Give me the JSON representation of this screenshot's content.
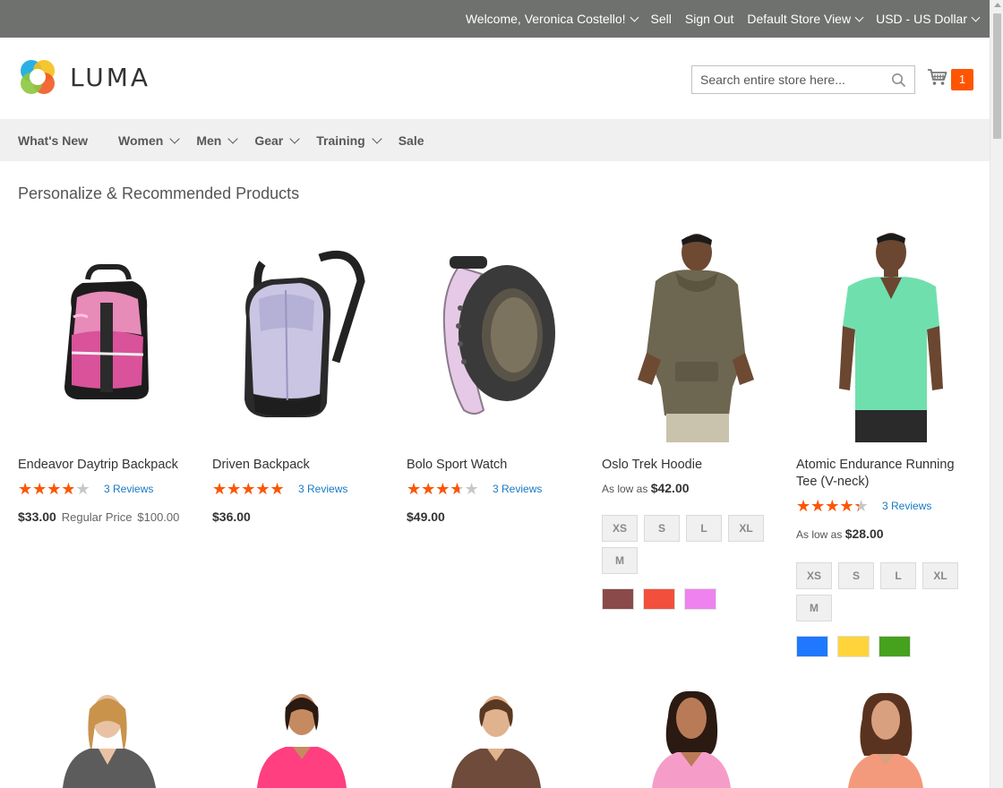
{
  "topbar": {
    "welcome": "Welcome, Veronica Costello!",
    "sell": "Sell",
    "sign_out": "Sign Out",
    "store_view": "Default Store View",
    "currency": "USD - US Dollar"
  },
  "header": {
    "logo_text": "LUMA",
    "search_placeholder": "Search entire store here...",
    "cart_count": "1"
  },
  "nav": {
    "items": [
      {
        "label": "What's New"
      },
      {
        "label": "Women"
      },
      {
        "label": "Men"
      },
      {
        "label": "Gear"
      },
      {
        "label": "Training"
      },
      {
        "label": "Sale"
      }
    ]
  },
  "section": {
    "title": "Personalize & Recommended Products"
  },
  "products": [
    {
      "name": "Endeavor Daytrip Backpack",
      "rating": 0.7,
      "reviews": "3 Reviews",
      "price": "$33.00",
      "regular_label": "Regular Price",
      "regular_price": "$100.00"
    },
    {
      "name": "Driven Backpack",
      "rating": 0.93,
      "reviews": "3 Reviews",
      "price": "$36.00"
    },
    {
      "name": "Bolo Sport Watch",
      "rating": 0.67,
      "reviews": "3 Reviews",
      "price": "$49.00"
    },
    {
      "name": "Oslo Trek Hoodie",
      "as_low_as_label": "As low as",
      "price": "$42.00",
      "sizes": [
        "XS",
        "S",
        "L",
        "XL",
        "M"
      ],
      "colors": [
        "#8b4a4a",
        "#f2503c",
        "#ee82ee"
      ]
    },
    {
      "name": "Atomic Endurance Running Tee (V-neck)",
      "rating": 0.8,
      "reviews": "3 Reviews",
      "as_low_as_label": "As low as",
      "price": "$28.00",
      "sizes": [
        "XS",
        "S",
        "L",
        "XL",
        "M"
      ],
      "colors": [
        "#1f78ff",
        "#ffd43b",
        "#46a11e"
      ]
    }
  ],
  "stars_glyphs": "★★★★★"
}
